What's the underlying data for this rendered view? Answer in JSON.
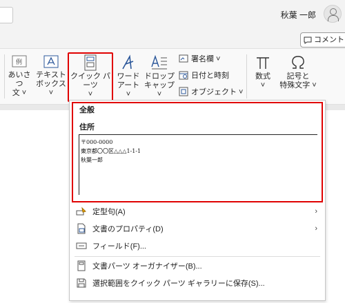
{
  "header": {
    "user_name": "秋葉 一郎",
    "comment_label": "コメント"
  },
  "ribbon": {
    "greeting": "あいさつ文",
    "greeting_line1": "あいさつ",
    "greeting_line2": "文 ˅",
    "textbox_line1": "テキスト",
    "textbox_line2": "ボックス ˅",
    "quickparts_line1": "クイック パーツ",
    "quickparts_line2": "˅",
    "wordart_line1": "ワード",
    "wordart_line2": "アート ˅",
    "dropcap_line1": "ドロップ",
    "dropcap_line2": "キャップ ˅",
    "signature_line": "署名欄  ˅",
    "datetime": "日付と時刻",
    "object": "オブジェクト  ˅",
    "equation_line1": "数式",
    "equation_line2": "˅",
    "symbol_line1": "記号と",
    "symbol_line2": "特殊文字 ˅",
    "greeting_icon_text": "例"
  },
  "gallery": {
    "section_title": "全般",
    "entry_title": "住所",
    "lines": [
      "〒000-0000",
      "東京都〇〇区△△△1-1-1",
      "秋葉一郎"
    ]
  },
  "menu": {
    "items": [
      {
        "label": "定型句(A)",
        "icon": "autotext-icon",
        "has_submenu": true
      },
      {
        "label": "文書のプロパティ(D)",
        "icon": "document-property-icon",
        "has_submenu": true
      },
      {
        "label": "フィールド(F)...",
        "icon": "field-icon",
        "has_submenu": false
      },
      {
        "label": "文書パーツ オーガナイザー(B)...",
        "icon": "building-blocks-icon",
        "has_submenu": false
      },
      {
        "label": "選択範囲をクイック パーツ ギャラリーに保存(S)...",
        "icon": "save-icon",
        "has_submenu": false
      }
    ]
  },
  "colors": {
    "highlight": "#e00000",
    "accent": "#2b579a"
  }
}
